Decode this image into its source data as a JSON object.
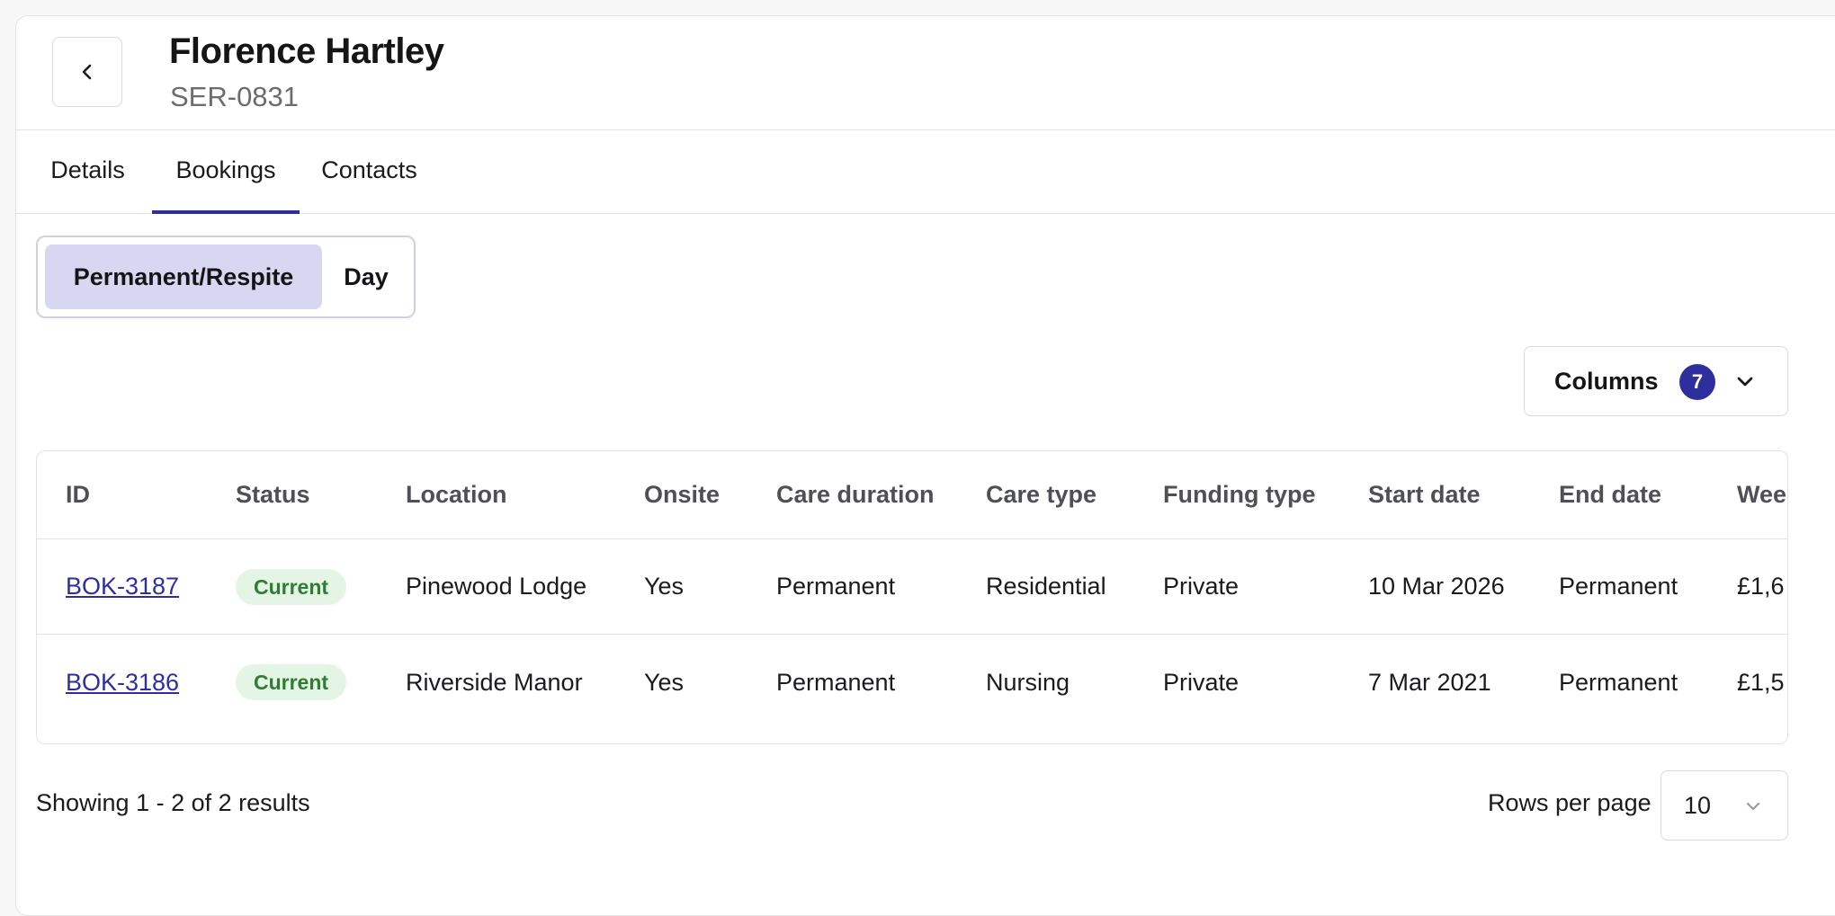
{
  "header": {
    "title": "Florence Hartley",
    "subtitle": "SER-0831",
    "back_icon": "chevron-left-icon"
  },
  "tabs": [
    {
      "label": "Details",
      "active": false
    },
    {
      "label": "Bookings",
      "active": true
    },
    {
      "label": "Contacts",
      "active": false
    }
  ],
  "segmented": {
    "options": [
      {
        "label": "Permanent/Respite",
        "active": true
      },
      {
        "label": "Day",
        "active": false
      }
    ]
  },
  "columns_button": {
    "label": "Columns",
    "count": "7",
    "icon": "chevron-down-icon"
  },
  "table": {
    "headers": [
      "ID",
      "Status",
      "Location",
      "Onsite",
      "Care duration",
      "Care type",
      "Funding type",
      "Start date",
      "End date",
      "Wee"
    ],
    "rows": [
      {
        "id": "BOK-3187",
        "status": "Current",
        "location": "Pinewood Lodge",
        "onsite": "Yes",
        "care_duration": "Permanent",
        "care_type": "Residential",
        "funding_type": "Private",
        "start_date": "10 Mar 2026",
        "end_date": "Permanent",
        "weekly": "£1,6"
      },
      {
        "id": "BOK-3186",
        "status": "Current",
        "location": "Riverside Manor",
        "onsite": "Yes",
        "care_duration": "Permanent",
        "care_type": "Nursing",
        "funding_type": "Private",
        "start_date": "7 Mar 2021",
        "end_date": "Permanent",
        "weekly": "£1,5"
      }
    ]
  },
  "footer": {
    "showing": "Showing 1 - 2 of 2 results",
    "rows_per_page_label": "Rows per page",
    "rows_per_page_value": "10"
  },
  "colors": {
    "accent": "#2d2f9e",
    "segment_active_bg": "#d8d7f2",
    "status_bg": "#e4f5e6",
    "status_text": "#2e7d32"
  }
}
